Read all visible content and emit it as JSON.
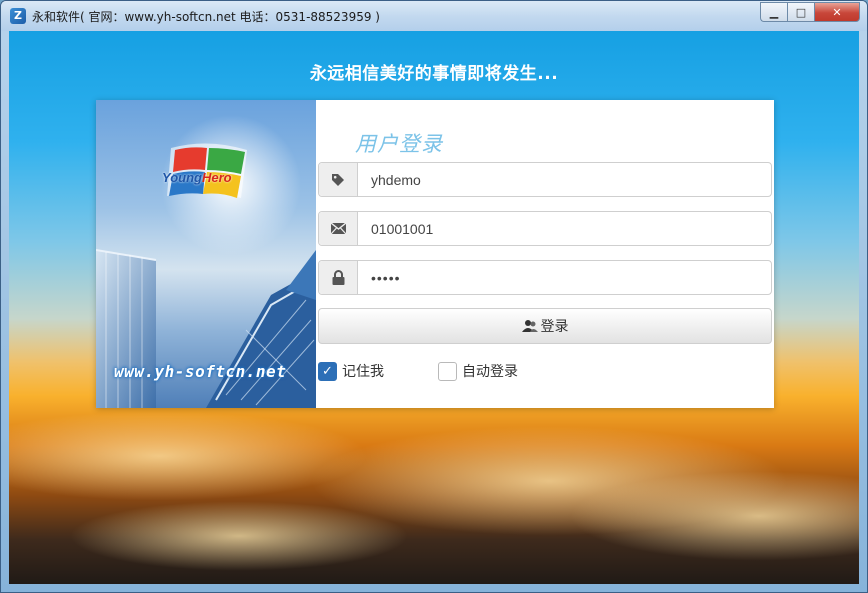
{
  "window": {
    "title": "永和软件( 官网：www.yh-softcn.net 电话：0531-88523959 )",
    "icon": "app-logo-icon",
    "controls": {
      "minimize": "▁",
      "maximize": "□",
      "close": "✕"
    }
  },
  "slogan": "永远相信美好的事情即将发生...",
  "banner": {
    "logo_text_young": "Young",
    "logo_text_hero": "Hero",
    "url": "www.yh-softcn.net"
  },
  "login": {
    "title": "用户登录",
    "username": {
      "value": "yhdemo",
      "icon": "tag-icon"
    },
    "account": {
      "value": "01001001",
      "icon": "envelope-icon"
    },
    "password": {
      "value": "•••••",
      "icon": "lock-icon"
    },
    "submit_label": "登录",
    "remember_label": "记住我",
    "remember_checked": true,
    "auto_login_label": "自动登录",
    "auto_login_checked": false
  },
  "colors": {
    "title_accent": "#7cc3e8",
    "checkbox_checked": "#2c6fb7",
    "sky_top": "#16a0e3",
    "sunset": "#f9b12d"
  }
}
